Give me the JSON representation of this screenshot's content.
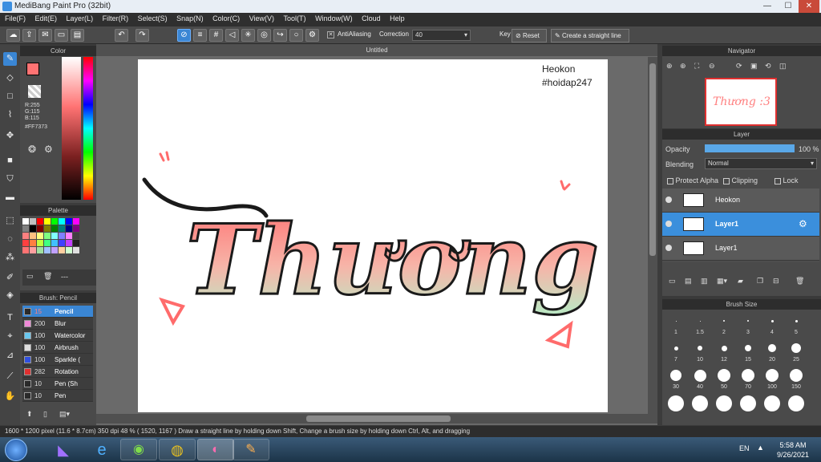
{
  "window": {
    "title": "MediBang Paint Pro (32bit)",
    "minimize": "—",
    "maximize": "☐",
    "close": "✕"
  },
  "menu": [
    "File(F)",
    "Edit(E)",
    "Layer(L)",
    "Filter(R)",
    "Select(S)",
    "Snap(N)",
    "Color(C)",
    "View(V)",
    "Tool(T)",
    "Window(W)",
    "Cloud",
    "Help"
  ],
  "toolbar": {
    "antialiasing_label": "AntiAliasing",
    "correction_label": "Correction",
    "correction_value": "40",
    "key_label": "Key",
    "reset_label": "Reset",
    "straight_line_label": "Create a straight line"
  },
  "color_panel": {
    "title": "Color",
    "r": "R:255",
    "g": "G:115",
    "b": "B:115",
    "hex": "#FF7373",
    "primary_color": "#FF7373",
    "secondary_color": "#FF8C00"
  },
  "palette_panel": {
    "title": "Palette",
    "footer_text": "---"
  },
  "brush_panel": {
    "title": "Brush: Pencil",
    "items": [
      {
        "size": "15",
        "name": "Pencil",
        "swatch": "#2a2a2a",
        "selected": true
      },
      {
        "size": "200",
        "name": "Blur",
        "swatch": "#f08ad8"
      },
      {
        "size": "100",
        "name": "Watercolor",
        "swatch": "#6ac8f0"
      },
      {
        "size": "100",
        "name": "Airbrush",
        "swatch": "#e0e0e0"
      },
      {
        "size": "100",
        "name": "Sparkle (",
        "swatch": "#3050e0"
      },
      {
        "size": "282",
        "name": "Rotation",
        "swatch": "#e03030"
      },
      {
        "size": "10",
        "name": "Pen (Sh",
        "swatch": "#2a2a2a"
      },
      {
        "size": "10",
        "name": "Pen",
        "swatch": "#2a2a2a"
      }
    ]
  },
  "canvas": {
    "tab_title": "Untitled",
    "watermark_line1": "Heokon",
    "watermark_line2": "#hoidap247",
    "artwork_text": "Thương :3"
  },
  "navigator": {
    "title": "Navigator"
  },
  "layer_panel": {
    "title": "Layer",
    "opacity_label": "Opacity",
    "opacity_value": "100 %",
    "opacity_fraction": 1.0,
    "blending_label": "Blending",
    "blending_value": "Normal",
    "protect_alpha": "Protect Alpha",
    "clipping": "Clipping",
    "lock": "Lock",
    "layers": [
      {
        "name": "Heokon",
        "selected": false
      },
      {
        "name": "Layer1",
        "selected": true
      },
      {
        "name": "Layer1",
        "selected": false
      }
    ]
  },
  "brush_size_panel": {
    "title": "Brush Size",
    "row1": [
      "1",
      "1.5",
      "2",
      "3",
      "4",
      "5"
    ],
    "row2": [
      "7",
      "10",
      "12",
      "15",
      "20",
      "25"
    ],
    "row3": [
      "30",
      "40",
      "50",
      "70",
      "100",
      "150"
    ]
  },
  "status": {
    "text": "1600 * 1200 pixel  (11.6 * 8.7cm)  350 dpi  48 %  ( 1520, 1167 )  Draw a straight line by holding down Shift, Change a brush size by holding down Ctrl, Alt, and dragging"
  },
  "taskbar": {
    "lang": "EN",
    "time": "5:58 AM",
    "date": "9/26/2021"
  },
  "colors": {
    "accent": "#3a86d4",
    "canvas_bg": "#ffffff",
    "pink": "#ff7373",
    "mint": "#b8ecc6"
  }
}
